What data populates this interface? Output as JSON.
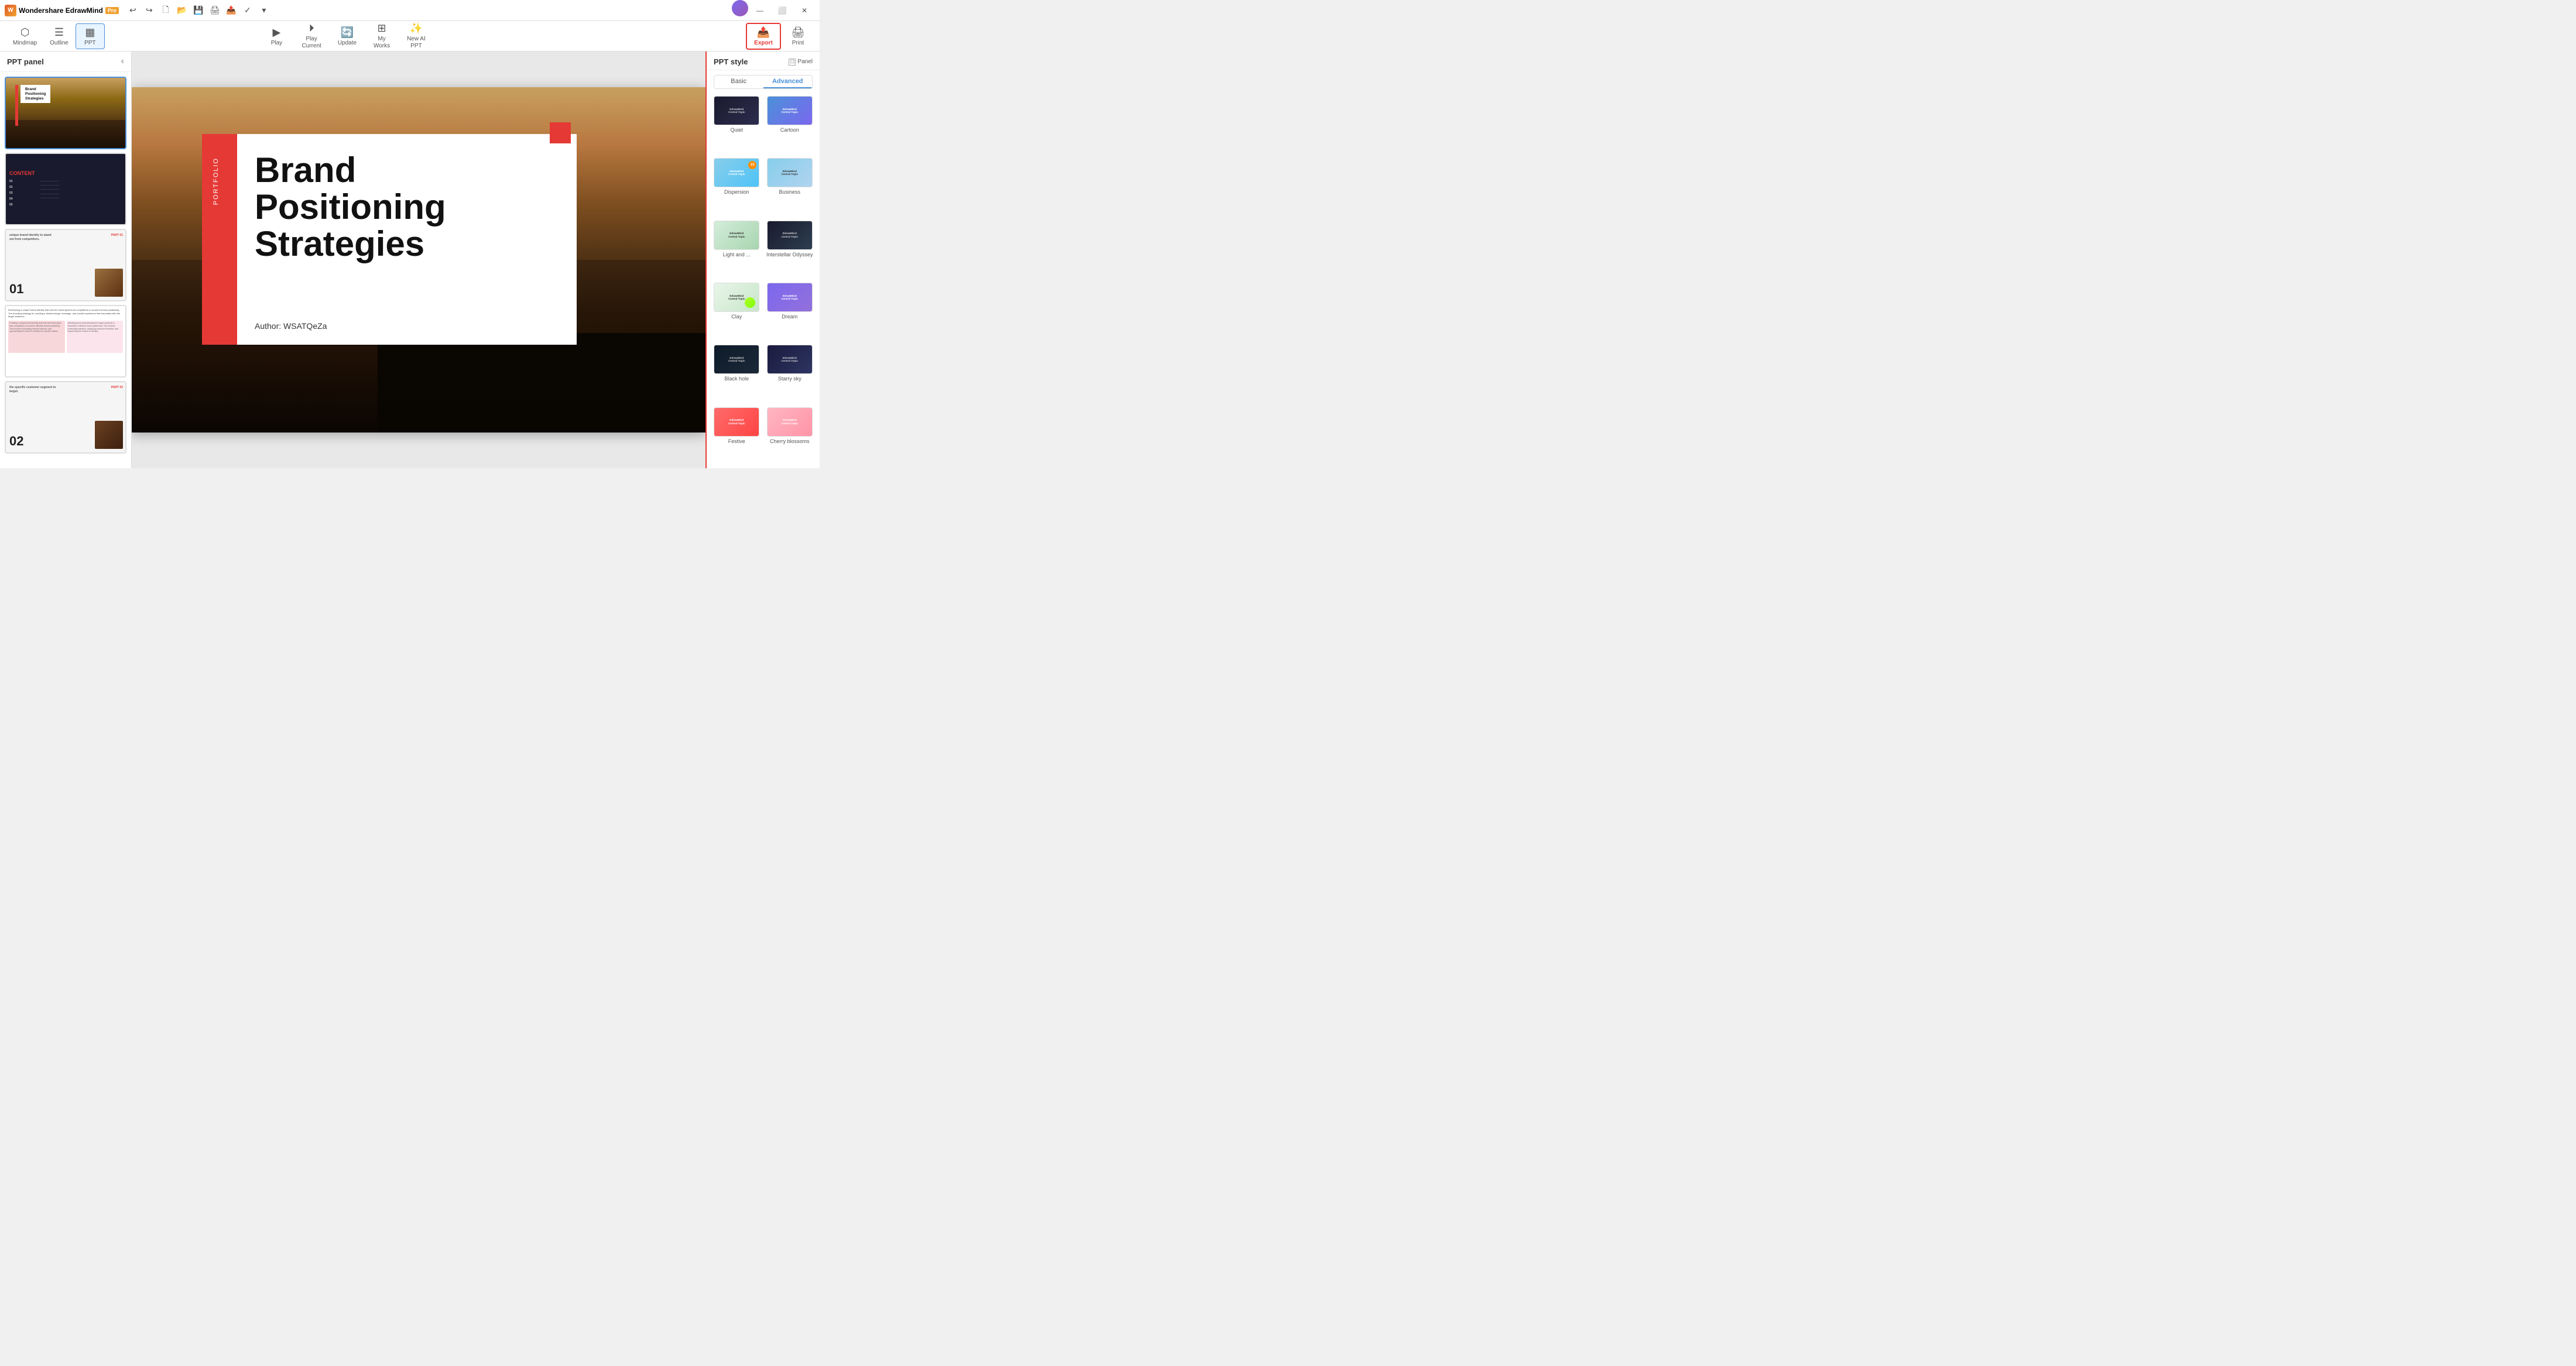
{
  "app": {
    "name": "Wondershare EdrawMind",
    "edition": "Pro"
  },
  "titlebar": {
    "undo": "↩",
    "redo": "↪",
    "new": "🗋",
    "open": "📁",
    "save": "💾",
    "print_preview": "🖨",
    "export_small": "📤",
    "check": "✓",
    "more": "▾",
    "minimize": "—",
    "maximize": "⬜",
    "close": "✕"
  },
  "toolbar": {
    "mindmap_label": "Mindmap",
    "outline_label": "Outline",
    "ppt_label": "PPT",
    "play_label": "Play",
    "play_current_label": "Play\nCurrent",
    "update_label": "Update",
    "my_works_label": "My\nWorks",
    "new_ai_label": "New AI\nPPT",
    "export_label": "Export",
    "print_label": "Print"
  },
  "left_panel": {
    "title": "PPT panel",
    "collapse_icon": "‹",
    "slides": [
      {
        "id": 1,
        "type": "cover",
        "active": true,
        "title": "Brand Positioning Strategies"
      },
      {
        "id": 2,
        "type": "content",
        "label": "CONTENT",
        "items": [
          "01",
          "02",
          "03",
          "04",
          "05"
        ]
      },
      {
        "id": 3,
        "type": "section",
        "text": "unique brand identity to stand out from competitors.",
        "part": "PART 01",
        "number": "01"
      },
      {
        "id": 4,
        "type": "detail",
        "text": "Developing a unique brand identity..."
      },
      {
        "id": 5,
        "type": "section2",
        "text": "the specific customer segment to target.",
        "part": "PART 02",
        "number": "02"
      }
    ]
  },
  "canvas": {
    "slide_title": "Brand\nPositioning\nStrategies",
    "author": "Author: WSATQeZa",
    "portfolio_text": "PORTFOLIO"
  },
  "right_panel": {
    "title": "PPT style",
    "panel_checkbox": "Panel",
    "tabs": [
      {
        "id": "basic",
        "label": "Basic",
        "active": false
      },
      {
        "id": "advanced",
        "label": "Advanced",
        "active": true
      }
    ],
    "styles": [
      {
        "id": "quiet",
        "name": "Quiet",
        "selected": false
      },
      {
        "id": "cartoon",
        "name": "Cartoon",
        "selected": false
      },
      {
        "id": "dispersion",
        "name": "Dispersion",
        "selected": false
      },
      {
        "id": "business",
        "name": "Business",
        "selected": false
      },
      {
        "id": "light",
        "name": "Light and ...",
        "selected": false
      },
      {
        "id": "interstellar",
        "name": "Interstellar Odyssey",
        "selected": false
      },
      {
        "id": "clay",
        "name": "Clay",
        "selected": false
      },
      {
        "id": "dream",
        "name": "Dream",
        "selected": false
      },
      {
        "id": "blackhole",
        "name": "Black hole",
        "selected": false
      },
      {
        "id": "starry",
        "name": "Starry sky",
        "selected": false
      },
      {
        "id": "festive",
        "name": "Festive",
        "selected": false
      },
      {
        "id": "cherry",
        "name": "Cherry blossoms",
        "selected": false
      }
    ],
    "style_thumb_label": "EdrawMind Central Topic"
  }
}
